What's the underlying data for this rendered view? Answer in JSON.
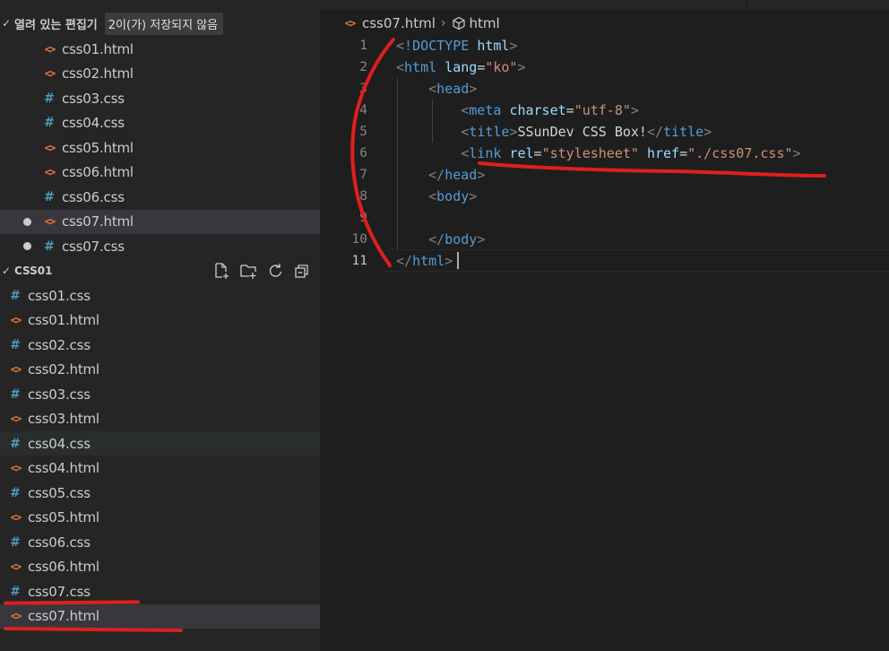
{
  "open_editors": {
    "title": "열려 있는 편집기",
    "badge": "2이(가) 저장되지 않음",
    "files": [
      {
        "name": "css01.html",
        "type": "html",
        "dirty": false
      },
      {
        "name": "css02.html",
        "type": "html",
        "dirty": false
      },
      {
        "name": "css03.css",
        "type": "css",
        "dirty": false
      },
      {
        "name": "css04.css",
        "type": "css",
        "dirty": false
      },
      {
        "name": "css05.html",
        "type": "html",
        "dirty": false
      },
      {
        "name": "css06.html",
        "type": "html",
        "dirty": false
      },
      {
        "name": "css06.css",
        "type": "css",
        "dirty": false
      },
      {
        "name": "css07.html",
        "type": "html",
        "dirty": true
      },
      {
        "name": "css07.css",
        "type": "css",
        "dirty": true
      }
    ]
  },
  "explorer": {
    "title": "CSS01",
    "actions": [
      "new-file-icon",
      "new-folder-icon",
      "refresh-icon",
      "collapse-all-icon"
    ],
    "files": [
      {
        "name": "css01.css",
        "type": "css"
      },
      {
        "name": "css01.html",
        "type": "html"
      },
      {
        "name": "css02.css",
        "type": "css"
      },
      {
        "name": "css02.html",
        "type": "html"
      },
      {
        "name": "css03.css",
        "type": "css"
      },
      {
        "name": "css03.html",
        "type": "html"
      },
      {
        "name": "css04.css",
        "type": "css"
      },
      {
        "name": "css04.html",
        "type": "html"
      },
      {
        "name": "css05.css",
        "type": "css"
      },
      {
        "name": "css05.html",
        "type": "html"
      },
      {
        "name": "css06.css",
        "type": "css"
      },
      {
        "name": "css06.html",
        "type": "html"
      },
      {
        "name": "css07.css",
        "type": "css"
      },
      {
        "name": "css07.html",
        "type": "html"
      }
    ]
  },
  "breadcrumb": {
    "file": "css07.html",
    "symbol": "html"
  },
  "code_lines": [
    [
      [
        "t-br",
        "<!"
      ],
      [
        "t-tag",
        "DOCTYPE"
      ],
      [
        "t-txt",
        " "
      ],
      [
        "t-attr",
        "html"
      ],
      [
        "t-br",
        ">"
      ]
    ],
    [
      [
        "t-br",
        "<"
      ],
      [
        "t-tag",
        "html"
      ],
      [
        "t-txt",
        " "
      ],
      [
        "t-attr",
        "lang"
      ],
      [
        "t-txt",
        "="
      ],
      [
        "t-str",
        "\"ko\""
      ],
      [
        "t-br",
        ">"
      ]
    ],
    [
      [
        "t-txt",
        "    "
      ],
      [
        "t-br",
        "<"
      ],
      [
        "t-tag",
        "head"
      ],
      [
        "t-br",
        ">"
      ]
    ],
    [
      [
        "t-txt",
        "        "
      ],
      [
        "t-br",
        "<"
      ],
      [
        "t-tag",
        "meta"
      ],
      [
        "t-txt",
        " "
      ],
      [
        "t-attr",
        "charset"
      ],
      [
        "t-txt",
        "="
      ],
      [
        "t-str",
        "\"utf-8\""
      ],
      [
        "t-br",
        ">"
      ]
    ],
    [
      [
        "t-txt",
        "        "
      ],
      [
        "t-br",
        "<"
      ],
      [
        "t-tag",
        "title"
      ],
      [
        "t-br",
        ">"
      ],
      [
        "t-txt",
        "SSunDev CSS Box!"
      ],
      [
        "t-br",
        "</"
      ],
      [
        "t-tag",
        "title"
      ],
      [
        "t-br",
        ">"
      ]
    ],
    [
      [
        "t-txt",
        "        "
      ],
      [
        "t-br",
        "<"
      ],
      [
        "t-tag",
        "link"
      ],
      [
        "t-txt",
        " "
      ],
      [
        "t-attr",
        "rel"
      ],
      [
        "t-txt",
        "="
      ],
      [
        "t-str",
        "\"stylesheet\""
      ],
      [
        "t-txt",
        " "
      ],
      [
        "t-attr",
        "href"
      ],
      [
        "t-txt",
        "="
      ],
      [
        "t-str",
        "\"./css07.css\""
      ],
      [
        "t-br",
        ">"
      ]
    ],
    [
      [
        "t-txt",
        "    "
      ],
      [
        "t-br",
        "</"
      ],
      [
        "t-tag",
        "head"
      ],
      [
        "t-br",
        ">"
      ]
    ],
    [
      [
        "t-txt",
        "    "
      ],
      [
        "t-br",
        "<"
      ],
      [
        "t-tag",
        "body"
      ],
      [
        "t-br",
        ">"
      ]
    ],
    [
      [
        "t-txt",
        ""
      ]
    ],
    [
      [
        "t-txt",
        "    "
      ],
      [
        "t-br",
        "</"
      ],
      [
        "t-tag",
        "body"
      ],
      [
        "t-br",
        ">"
      ]
    ],
    [
      [
        "t-br",
        "</"
      ],
      [
        "t-tag",
        "html"
      ],
      [
        "t-br",
        ">"
      ]
    ]
  ],
  "current_line": 11,
  "colors": {
    "accent_html": "#e37933",
    "accent_css": "#519aba",
    "annotation_red": "#e01e1e"
  }
}
